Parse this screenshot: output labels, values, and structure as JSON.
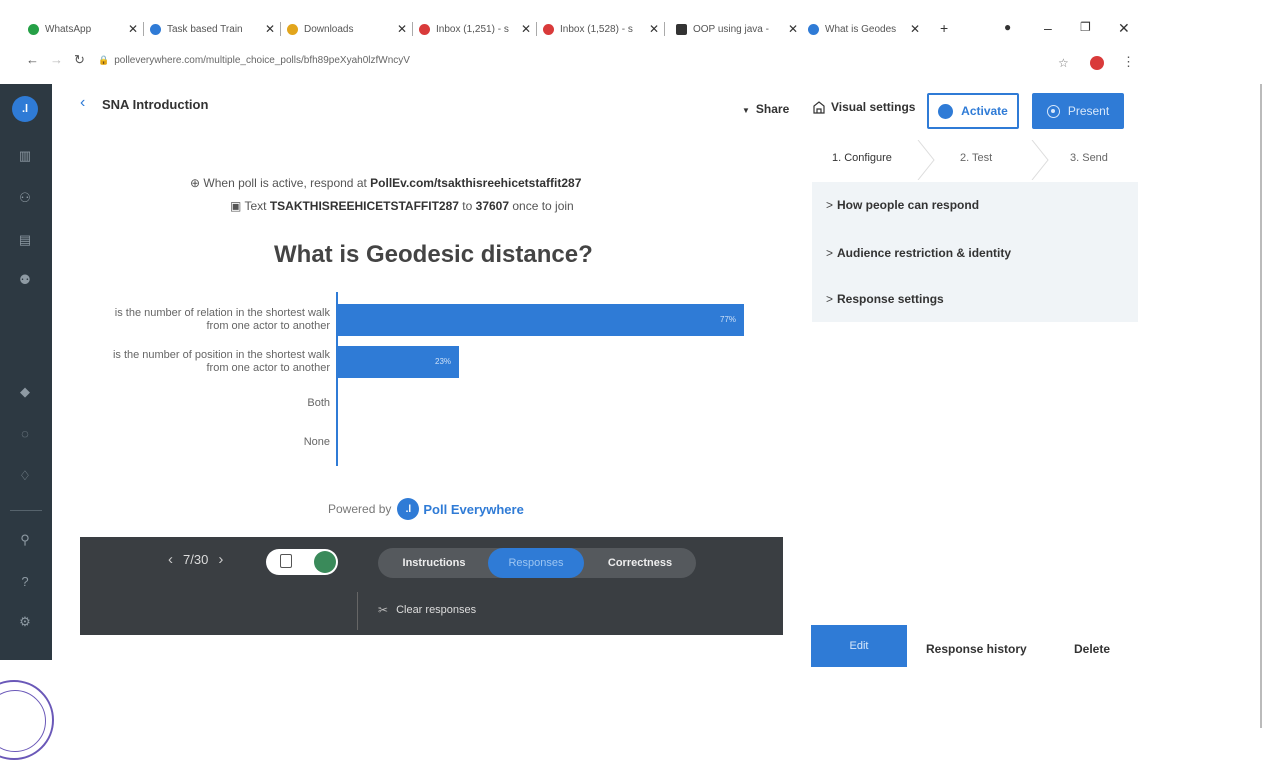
{
  "browser": {
    "tabs": [
      {
        "label": "WhatsApp",
        "favicon_color": "#25a046"
      },
      {
        "label": "Task based Train",
        "favicon_color": "#2f7bd6"
      },
      {
        "label": "Downloads",
        "favicon_color": "#e2a51c"
      },
      {
        "label": "Inbox (1,251) - s",
        "favicon_color": "#d93a3a"
      },
      {
        "label": "Inbox (1,528) - s",
        "favicon_color": "#d93a3a"
      },
      {
        "label": "OOP using java -",
        "favicon_color": "#333333"
      },
      {
        "label": "What is Geodes",
        "favicon_color": "#2f7bd6"
      }
    ],
    "new_tab_glyph": "+",
    "url": "polleverywhere.com/multiple_choice_polls/bfh89peXyah0lzfWncyV"
  },
  "header": {
    "title": "SNA Introduction",
    "share_label": "Share",
    "visual_settings_label": "Visual settings",
    "activate_label": "Activate",
    "present_label": "Present"
  },
  "steps": [
    "1. Configure",
    "2. Test",
    "3. Send"
  ],
  "settings": {
    "items": [
      "How people can respond",
      "Audience restriction & identity",
      "Response settings"
    ]
  },
  "poll": {
    "instr_web_prefix": "When poll is active, respond at ",
    "instr_web_url": "PollEv.com/tsakthisreehicetstaffit287",
    "instr_text_prefix": "Text ",
    "instr_text_code": "TSAKTHISREEHICETSTAFFIT287",
    "instr_text_mid": " to ",
    "instr_text_number": "37607",
    "instr_text_suffix": " once to join",
    "question": "What is Geodesic distance?",
    "powered_by": "Powered by",
    "brand": "Poll Everywhere"
  },
  "chart_data": {
    "type": "bar",
    "orientation": "horizontal",
    "categories": [
      "is the number of relation in the shortest walk from one actor to another",
      "is the number of position in the shortest walk from one actor to another",
      "Both",
      "None"
    ],
    "values": [
      77,
      23,
      0,
      0
    ],
    "value_labels": [
      "77%",
      "23%",
      "",
      ""
    ],
    "xlim": [
      0,
      100
    ],
    "color": "#2f7bd6"
  },
  "toolbar": {
    "page_indicator": "7/30",
    "segments": [
      "Instructions",
      "Responses",
      "Correctness"
    ],
    "active_segment": "Responses",
    "clear_label": "Clear responses"
  },
  "actions": {
    "edit_label": "Edit",
    "history_label": "Response history",
    "delete_label": "Delete"
  },
  "colors": {
    "accent": "#2f7bd6",
    "sidebar": "#2d3942",
    "toolbar": "#3a3e42"
  }
}
